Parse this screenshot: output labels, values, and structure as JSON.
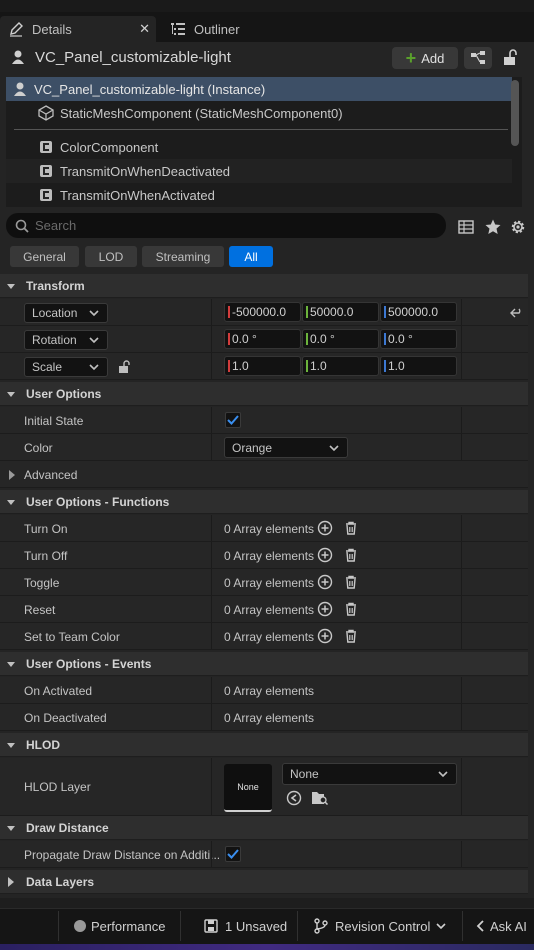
{
  "tabs": {
    "details": "Details",
    "details_close": "✕",
    "outliner": "Outliner"
  },
  "actor": {
    "name": "VC_Panel_customizable-light",
    "add_label": "Add"
  },
  "tree": {
    "items": [
      {
        "label": "VC_Panel_customizable-light (Instance)",
        "icon": "actor-icon"
      },
      {
        "label": "StaticMeshComponent (StaticMeshComponent0)",
        "icon": "static-mesh-icon"
      },
      {
        "label": "ColorComponent",
        "icon": "component-icon"
      },
      {
        "label": "TransmitOnWhenDeactivated",
        "icon": "component-icon"
      },
      {
        "label": "TransmitOnWhenActivated",
        "icon": "component-icon"
      }
    ]
  },
  "search": {
    "placeholder": "Search"
  },
  "filters": [
    "General",
    "LOD",
    "Streaming",
    "All"
  ],
  "transform": {
    "title": "Transform",
    "location_label": "Location",
    "rotation_label": "Rotation",
    "scale_label": "Scale",
    "location": [
      "-500000.0",
      "50000.0",
      "500000.0"
    ],
    "rotation": [
      "0.0 °",
      "0.0 °",
      "0.0 °"
    ],
    "scale": [
      "1.0",
      "1.0",
      "1.0"
    ]
  },
  "user_options": {
    "title": "User Options",
    "initial_state_label": "Initial State",
    "initial_state": true,
    "color_label": "Color",
    "color_value": "Orange",
    "advanced_label": "Advanced"
  },
  "functions": {
    "title": "User Options - Functions",
    "rows": [
      {
        "label": "Turn On",
        "value": "0 Array elements"
      },
      {
        "label": "Turn Off",
        "value": "0 Array elements"
      },
      {
        "label": "Toggle",
        "value": "0 Array elements"
      },
      {
        "label": "Reset",
        "value": "0 Array elements"
      },
      {
        "label": "Set to Team Color",
        "value": "0 Array elements"
      }
    ]
  },
  "events": {
    "title": "User Options - Events",
    "rows": [
      {
        "label": "On Activated",
        "value": "0 Array elements"
      },
      {
        "label": "On Deactivated",
        "value": "0 Array elements"
      }
    ]
  },
  "hlod": {
    "title": "HLOD",
    "layer_label": "HLOD Layer",
    "thumb_text": "None",
    "dropdown_value": "None"
  },
  "draw_distance": {
    "title": "Draw Distance",
    "propagate_label": "Propagate Draw Distance on Additi...",
    "propagate": true
  },
  "data_layers": {
    "title": "Data Layers"
  },
  "status": {
    "performance": "Performance",
    "unsaved": "1 Unsaved",
    "revision": "Revision Control",
    "ask_ai": "Ask AI"
  },
  "colors": {
    "accent": "#0070e0",
    "selection": "#3d4f66",
    "axis_x": "#d23c3c",
    "axis_y": "#6cb43c",
    "axis_z": "#3c78d2"
  }
}
